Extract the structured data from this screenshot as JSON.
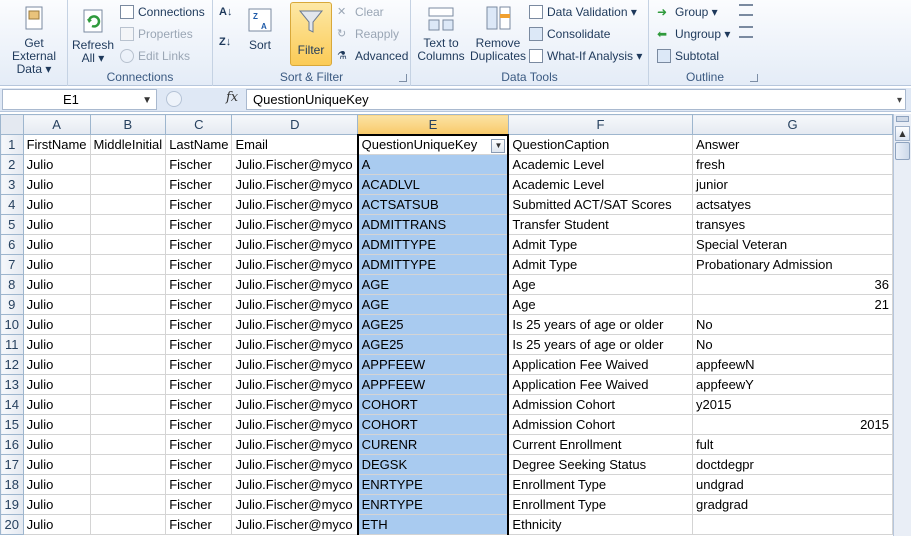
{
  "ribbon": {
    "get_external": {
      "line1": "Get External",
      "line2": "Data ▾"
    },
    "connections_group": {
      "refresh": {
        "line1": "Refresh",
        "line2": "All ▾"
      },
      "connections": "Connections",
      "properties": "Properties",
      "edit_links": "Edit Links",
      "label": "Connections"
    },
    "sort_filter_group": {
      "sort": "Sort",
      "filter": "Filter",
      "clear": "Clear",
      "reapply": "Reapply",
      "advanced": "Advanced",
      "label": "Sort & Filter"
    },
    "data_tools_group": {
      "text_to_columns": {
        "line1": "Text to",
        "line2": "Columns"
      },
      "remove_duplicates": {
        "line1": "Remove",
        "line2": "Duplicates"
      },
      "data_validation": "Data Validation ▾",
      "consolidate": "Consolidate",
      "what_if": "What-If Analysis ▾",
      "label": "Data Tools"
    },
    "outline_group": {
      "group": "Group ▾",
      "ungroup": "Ungroup ▾",
      "subtotal": "Subtotal",
      "label": "Outline"
    }
  },
  "formula_bar": {
    "name_box": "E1",
    "fx": "fx",
    "content": "QuestionUniqueKey"
  },
  "sheet": {
    "columns": [
      "A",
      "B",
      "C",
      "D",
      "E",
      "F",
      "G"
    ],
    "rows": [
      {
        "n": "1",
        "a": "FirstName",
        "b": "MiddleInitial",
        "c": "LastName",
        "d": "Email",
        "e": "QuestionUniqueKey",
        "f": "QuestionCaption",
        "g": "Answer"
      },
      {
        "n": "2",
        "a": "Julio",
        "b": "",
        "c": "Fischer",
        "d": "Julio.Fischer@myco",
        "e": "A",
        "f": "Academic Level",
        "g": "fresh"
      },
      {
        "n": "3",
        "a": "Julio",
        "b": "",
        "c": "Fischer",
        "d": "Julio.Fischer@myco",
        "e": "ACADLVL",
        "f": "Academic Level",
        "g": "junior"
      },
      {
        "n": "4",
        "a": "Julio",
        "b": "",
        "c": "Fischer",
        "d": "Julio.Fischer@myco",
        "e": "ACTSATSUB",
        "f": "Submitted ACT/SAT Scores",
        "g": "actsatyes"
      },
      {
        "n": "5",
        "a": "Julio",
        "b": "",
        "c": "Fischer",
        "d": "Julio.Fischer@myco",
        "e": "ADMITTRANS",
        "f": "Transfer Student",
        "g": "transyes"
      },
      {
        "n": "6",
        "a": "Julio",
        "b": "",
        "c": "Fischer",
        "d": "Julio.Fischer@myco",
        "e": "ADMITTYPE",
        "f": "Admit Type",
        "g": "Special Veteran"
      },
      {
        "n": "7",
        "a": "Julio",
        "b": "",
        "c": "Fischer",
        "d": "Julio.Fischer@myco",
        "e": "ADMITTYPE",
        "f": "Admit Type",
        "g": "Probationary Admission"
      },
      {
        "n": "8",
        "a": "Julio",
        "b": "",
        "c": "Fischer",
        "d": "Julio.Fischer@myco",
        "e": "AGE",
        "f": "Age",
        "g": "36",
        "g_num": true
      },
      {
        "n": "9",
        "a": "Julio",
        "b": "",
        "c": "Fischer",
        "d": "Julio.Fischer@myco",
        "e": "AGE",
        "f": "Age",
        "g": "21",
        "g_num": true
      },
      {
        "n": "10",
        "a": "Julio",
        "b": "",
        "c": "Fischer",
        "d": "Julio.Fischer@myco",
        "e": "AGE25",
        "f": "Is 25 years of age or older",
        "g": "No"
      },
      {
        "n": "11",
        "a": "Julio",
        "b": "",
        "c": "Fischer",
        "d": "Julio.Fischer@myco",
        "e": "AGE25",
        "f": "Is 25 years of age or older",
        "g": "No"
      },
      {
        "n": "12",
        "a": "Julio",
        "b": "",
        "c": "Fischer",
        "d": "Julio.Fischer@myco",
        "e": "APPFEEW",
        "f": "Application Fee Waived",
        "g": "appfeewN"
      },
      {
        "n": "13",
        "a": "Julio",
        "b": "",
        "c": "Fischer",
        "d": "Julio.Fischer@myco",
        "e": "APPFEEW",
        "f": "Application Fee Waived",
        "g": "appfeewY"
      },
      {
        "n": "14",
        "a": "Julio",
        "b": "",
        "c": "Fischer",
        "d": "Julio.Fischer@myco",
        "e": "COHORT",
        "f": "Admission Cohort",
        "g": "y2015"
      },
      {
        "n": "15",
        "a": "Julio",
        "b": "",
        "c": "Fischer",
        "d": "Julio.Fischer@myco",
        "e": "COHORT",
        "f": "Admission Cohort",
        "g": "2015",
        "g_num": true
      },
      {
        "n": "16",
        "a": "Julio",
        "b": "",
        "c": "Fischer",
        "d": "Julio.Fischer@myco",
        "e": "CURENR",
        "f": "Current Enrollment",
        "g": "fult"
      },
      {
        "n": "17",
        "a": "Julio",
        "b": "",
        "c": "Fischer",
        "d": "Julio.Fischer@myco",
        "e": "DEGSK",
        "f": "Degree Seeking Status",
        "g": "doctdegpr"
      },
      {
        "n": "18",
        "a": "Julio",
        "b": "",
        "c": "Fischer",
        "d": "Julio.Fischer@myco",
        "e": "ENRTYPE",
        "f": "Enrollment Type",
        "g": "undgrad"
      },
      {
        "n": "19",
        "a": "Julio",
        "b": "",
        "c": "Fischer",
        "d": "Julio.Fischer@myco",
        "e": "ENRTYPE",
        "f": "Enrollment Type",
        "g": "gradgrad"
      },
      {
        "n": "20",
        "a": "Julio",
        "b": "",
        "c": "Fischer",
        "d": "Julio.Fischer@myco",
        "e": "ETH",
        "f": "Ethnicity",
        "g": ""
      }
    ]
  },
  "colors": {
    "selected_column": "#a9cbf0",
    "selected_header": "#f8c96a",
    "ribbon_text": "#1e395b"
  }
}
